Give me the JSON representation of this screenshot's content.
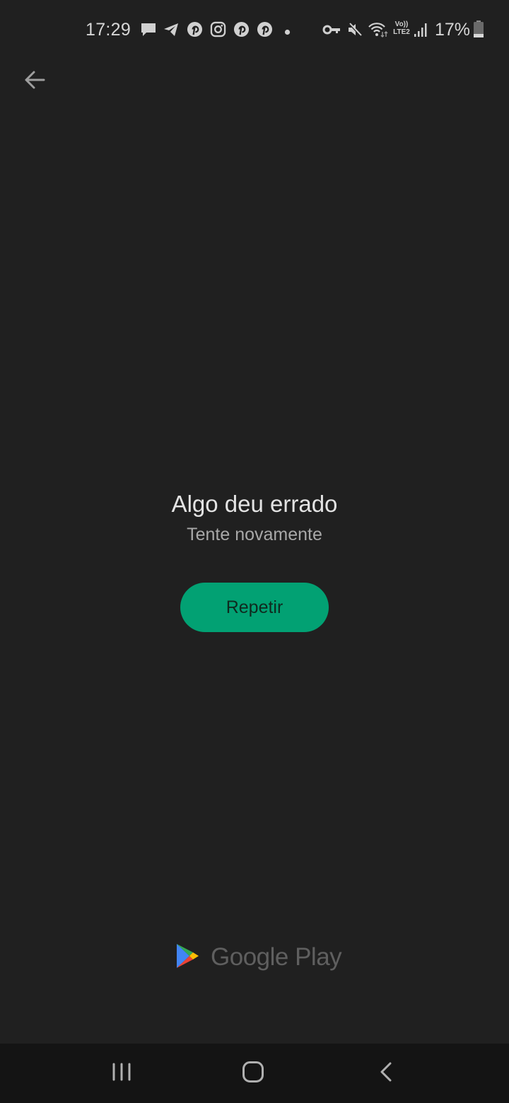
{
  "status_bar": {
    "time": "17:29",
    "notification_icons": [
      "message-icon",
      "telegram-icon",
      "pinterest-icon",
      "instagram-icon",
      "pinterest-icon",
      "pinterest-icon",
      "more-dot-icon"
    ],
    "system_icons": [
      "vpn-key-icon",
      "mute-icon",
      "wifi-icon",
      "volte-lte2-icon",
      "signal-icon"
    ],
    "volte_label_top": "Vo))",
    "volte_label_bottom": "LTE2",
    "battery_percent": "17%",
    "battery_level": 0.17
  },
  "header": {
    "back_icon": "arrow-back-icon"
  },
  "error": {
    "title": "Algo deu errado",
    "subtitle": "Tente novamente",
    "retry_label": "Repetir"
  },
  "footer": {
    "brand": "Google Play",
    "logo_icon": "google-play-logo-icon"
  },
  "nav_bar": {
    "recents_icon": "recents-icon",
    "home_icon": "home-icon",
    "back_icon": "nav-back-icon"
  },
  "colors": {
    "background": "#202020",
    "accent": "#02a173",
    "nav_background": "#141414"
  }
}
